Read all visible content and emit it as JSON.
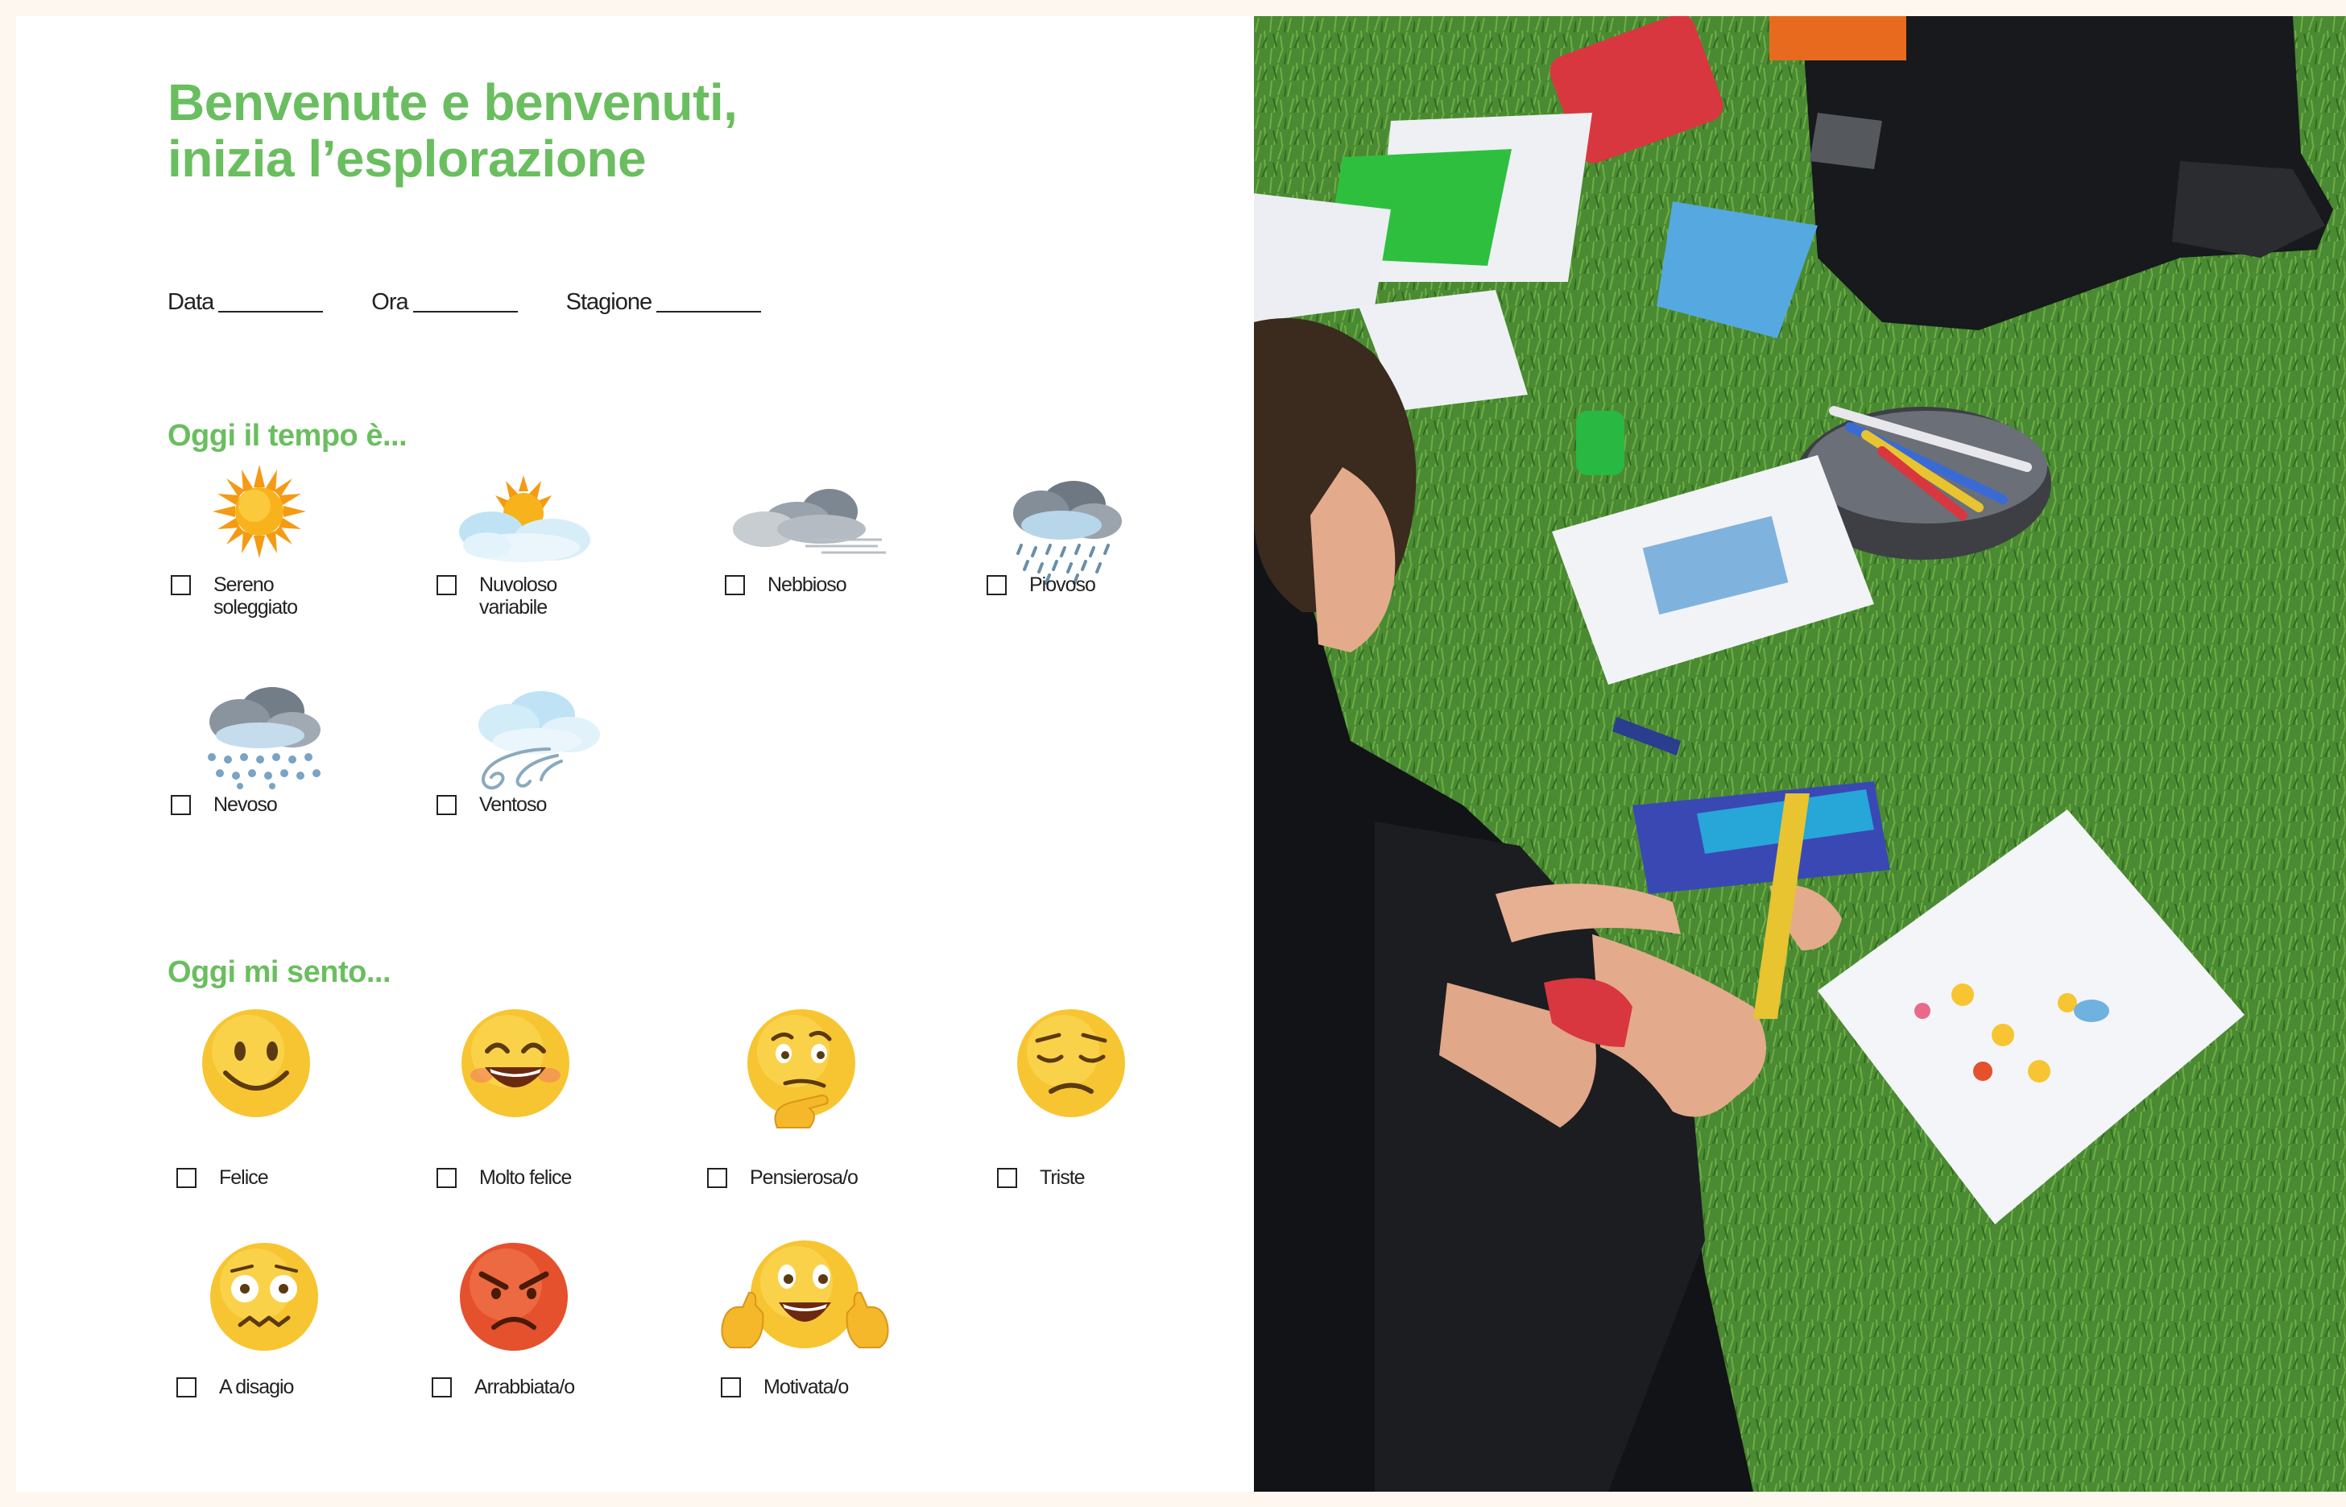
{
  "sheet": {
    "title_line1": "Benvenute e benvenuti,",
    "title_line2": "inizia l’esplorazione",
    "fields": [
      {
        "label": "Data"
      },
      {
        "label": "Ora"
      },
      {
        "label": "Stagione"
      }
    ],
    "weather_title": "Oggi il tempo è...",
    "weather": [
      {
        "label": "Sereno\nsoleggiato",
        "icon": "sun-icon"
      },
      {
        "label": "Nuvoloso\nvariabile",
        "icon": "partly-cloudy-icon"
      },
      {
        "label": "Nebbioso",
        "icon": "fog-icon"
      },
      {
        "label": "Piovoso",
        "icon": "rain-icon"
      },
      {
        "label": "Nevoso",
        "icon": "snow-icon"
      },
      {
        "label": "Ventoso",
        "icon": "wind-icon"
      }
    ],
    "mood_title": "Oggi mi sento...",
    "moods": [
      {
        "label": "Felice",
        "icon": "smiling-face-icon"
      },
      {
        "label": "Molto felice",
        "icon": "grinning-face-icon"
      },
      {
        "label": "Pensierosa/o",
        "icon": "thinking-face-icon"
      },
      {
        "label": "Triste",
        "icon": "sad-face-icon"
      },
      {
        "label": "A disagio",
        "icon": "uneasy-face-icon"
      },
      {
        "label": "Arrabbiata/o",
        "icon": "angry-face-icon"
      },
      {
        "label": "Motivata/o",
        "icon": "thumbs-up-face-icon"
      }
    ]
  },
  "colors": {
    "accent_green": "#6abe5f",
    "page_bg": "#fdf7ef",
    "emoji_yellow": "#f7c531",
    "angry_red": "#e5502d"
  }
}
